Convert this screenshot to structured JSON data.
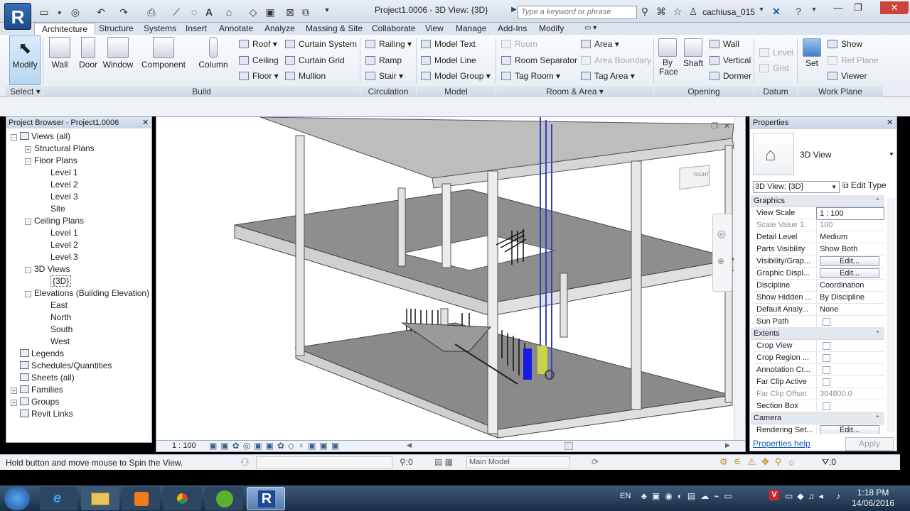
{
  "app": {
    "logo": "R",
    "title": "Project1.0006 - 3D View: {3D}",
    "search_placeholder": "Type a keyword or phrase",
    "user": "cachiusa_015"
  },
  "tabs": [
    "Architecture",
    "Structure",
    "Systems",
    "Insert",
    "Annotate",
    "Analyze",
    "Massing & Site",
    "Collaborate",
    "View",
    "Manage",
    "Add-Ins",
    "Modify"
  ],
  "ribbon": {
    "select": {
      "modify": "Modify",
      "label": "Select"
    },
    "build": {
      "label": "Build",
      "wall": "Wall",
      "door": "Door",
      "window": "Window",
      "component": "Component",
      "column": "Column",
      "roof": "Roof",
      "ceiling": "Ceiling",
      "floor": "Floor",
      "curtain_system": "Curtain System",
      "curtain_grid": "Curtain Grid",
      "mullion": "Mullion"
    },
    "circulation": {
      "label": "Circulation",
      "railing": "Railing",
      "ramp": "Ramp",
      "stair": "Stair"
    },
    "model": {
      "label": "Model",
      "model_text": "Model Text",
      "model_line": "Model Line",
      "model_group": "Model Group"
    },
    "room_area": {
      "label": "Room & Area",
      "room": "Room",
      "room_separator": "Room Separator",
      "tag_room": "Tag Room",
      "area": "Area",
      "area_boundary": "Area Boundary",
      "tag_area": "Tag Area"
    },
    "opening": {
      "label": "Opening",
      "by_face": "By Face",
      "shaft": "Shaft",
      "wall": "Wall",
      "vertical": "Vertical",
      "dormer": "Dormer"
    },
    "datum": {
      "label": "Datum",
      "level": "Level",
      "grid": "Grid"
    },
    "work_plane": {
      "label": "Work Plane",
      "set": "Set",
      "show": "Show",
      "ref_plane": "Ref Plane",
      "viewer": "Viewer"
    }
  },
  "project_browser": {
    "title": "Project Browser - Project1.0006",
    "items": [
      {
        "label": "Views (all)",
        "level": 0,
        "exp": "-"
      },
      {
        "label": "Structural Plans",
        "level": 1,
        "exp": "+"
      },
      {
        "label": "Floor Plans",
        "level": 1,
        "exp": "-"
      },
      {
        "label": "Level 1",
        "level": 2
      },
      {
        "label": "Level 2",
        "level": 2
      },
      {
        "label": "Level 3",
        "level": 2
      },
      {
        "label": "Site",
        "level": 2
      },
      {
        "label": "Ceiling Plans",
        "level": 1,
        "exp": "-"
      },
      {
        "label": "Level 1",
        "level": 2
      },
      {
        "label": "Level 2",
        "level": 2
      },
      {
        "label": "Level 3",
        "level": 2
      },
      {
        "label": "3D Views",
        "level": 1,
        "exp": "-"
      },
      {
        "label": "{3D}",
        "level": 2,
        "selected": true
      },
      {
        "label": "Elevations (Building Elevation)",
        "level": 1,
        "exp": "-"
      },
      {
        "label": "East",
        "level": 2
      },
      {
        "label": "North",
        "level": 2
      },
      {
        "label": "South",
        "level": 2
      },
      {
        "label": "West",
        "level": 2
      },
      {
        "label": "Legends",
        "level": 0
      },
      {
        "label": "Schedules/Quantities",
        "level": 0
      },
      {
        "label": "Sheets (all)",
        "level": 0
      },
      {
        "label": "Families",
        "level": 0,
        "exp": "+"
      },
      {
        "label": "Groups",
        "level": 0,
        "exp": "+"
      },
      {
        "label": "Revit Links",
        "level": 0
      }
    ]
  },
  "viewport": {
    "scale": "1 : 100",
    "viewcube_face": "RIGHT"
  },
  "properties": {
    "title": "Properties",
    "type": "3D View",
    "selector": "3D View: {3D}",
    "edit_type": "Edit Type",
    "groups": [
      {
        "name": "Graphics",
        "rows": [
          {
            "k": "View Scale",
            "v": "1 : 100",
            "input": true
          },
          {
            "k": "Scale Value    1:",
            "v": "100",
            "dis": true
          },
          {
            "k": "Detail Level",
            "v": "Medium"
          },
          {
            "k": "Parts Visibility",
            "v": "Show Both"
          },
          {
            "k": "Visibility/Grap...",
            "v": "Edit...",
            "btn": true
          },
          {
            "k": "Graphic Displ...",
            "v": "Edit...",
            "btn": true
          },
          {
            "k": "Discipline",
            "v": "Coordination"
          },
          {
            "k": "Show Hidden ...",
            "v": "By Discipline"
          },
          {
            "k": "Default Analy...",
            "v": "None"
          },
          {
            "k": "Sun Path",
            "v": "",
            "cb": true
          }
        ]
      },
      {
        "name": "Extents",
        "rows": [
          {
            "k": "Crop View",
            "v": "",
            "cb": true
          },
          {
            "k": "Crop Region ...",
            "v": "",
            "cb": true
          },
          {
            "k": "Annotation Cr...",
            "v": "",
            "cb": true
          },
          {
            "k": "Far Clip Active",
            "v": "",
            "cb": true
          },
          {
            "k": "Far Clip Offset",
            "v": "304800.0",
            "dis": true
          },
          {
            "k": "Section Box",
            "v": "",
            "cb": true
          }
        ]
      },
      {
        "name": "Camera",
        "rows": [
          {
            "k": "Rendering Set...",
            "v": "Edit...",
            "btn": true
          }
        ]
      }
    ],
    "help": "Properties help",
    "apply": "Apply"
  },
  "status": {
    "message": "Hold button and move mouse to Spin the View.",
    "count": ":0",
    "workset": "Main Model",
    "filter": ":0"
  },
  "taskbar": {
    "lang": "EN",
    "time": "1:18 PM",
    "date": "14/06/2016"
  },
  "colors": {
    "accent": "#2b5797",
    "revit": "#1c4a8c"
  }
}
